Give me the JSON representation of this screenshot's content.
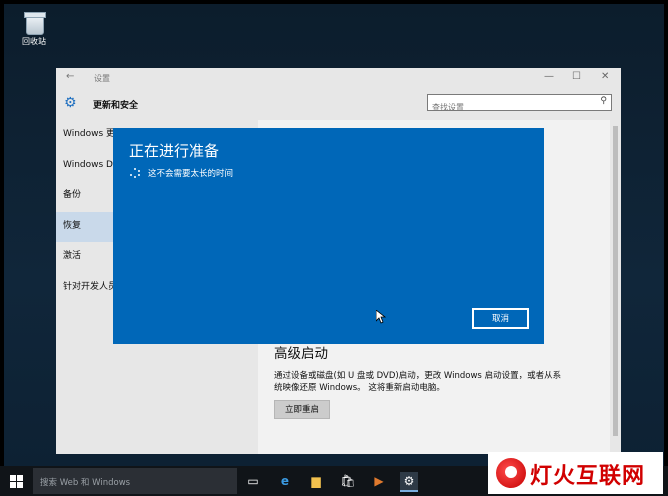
{
  "desktop": {
    "recycle_bin_label": "回收站"
  },
  "settings": {
    "window_title": "设置",
    "section_title": "更新和安全",
    "search_placeholder": "查找设置",
    "sidebar": [
      "Windows 更新",
      "Windows Defender",
      "备份",
      "恢复",
      "激活",
      "针对开发人员"
    ],
    "advanced_title": "高级启动",
    "advanced_desc": "通过设备或磁盘(如 U 盘或 DVD)启动，更改 Windows 启动设置，或者从系统映像还原 Windows。 这将重新启动电脑。",
    "restart_label": "立即重启"
  },
  "modal": {
    "title": "正在进行准备",
    "subtitle": "这不会需要太长的时间",
    "cancel_label": "取消"
  },
  "taskbar": {
    "search_placeholder": "搜索 Web 和 Windows"
  },
  "watermark": {
    "text": "灯火互联网"
  },
  "colors": {
    "modal_bg": "#0067b8",
    "nav_active": "#c9d9ea"
  }
}
